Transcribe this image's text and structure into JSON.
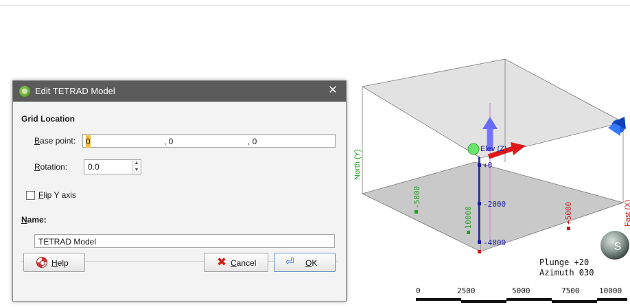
{
  "dialog": {
    "title": "Edit TETRAD Model",
    "close_symbol": "✕",
    "grid_location": {
      "heading": "Grid Location"
    },
    "base_point": {
      "label_prefix": "B",
      "label_rest": "ase point:",
      "x": "0",
      "y": ", 0",
      "z": ", 0"
    },
    "rotation": {
      "label_prefix": "R",
      "label_rest": "otation:",
      "value": "0.0"
    },
    "flip_y": {
      "label_prefix": "F",
      "label_rest": "lip Y axis",
      "checked": false
    },
    "name": {
      "label_prefix": "N",
      "label_rest": "ame:",
      "value": "TETRAD Model"
    },
    "buttons": {
      "help_prefix": "H",
      "help_rest": "elp",
      "cancel_prefix": "C",
      "cancel_rest": "ancel",
      "ok_prefix": "O",
      "ok_rest": "K"
    }
  },
  "viewport": {
    "axes": {
      "north": "North (Y)",
      "east": "Fast (X)",
      "elev": "Elev (Z)"
    },
    "tick_labels": {
      "z_plus0": "+0",
      "z_minus2000": "-2000",
      "z_minus4000": "-4000",
      "x_plus5000": "+5000",
      "y_minus5000": "-5000",
      "y_minus10000": "-10000"
    },
    "orientation": {
      "plunge": "Plunge +20",
      "azimuth": "Azimuth 030"
    },
    "scale_bar": [
      "0",
      "2500",
      "5000",
      "7500",
      "10000"
    ]
  },
  "colors": {
    "titlebar": "#5b5b5b",
    "dialog_bg": "#f3f3f3",
    "z_axis": "#1a1aa8",
    "x_axis": "#c41c1c",
    "y_axis": "#21a021"
  }
}
